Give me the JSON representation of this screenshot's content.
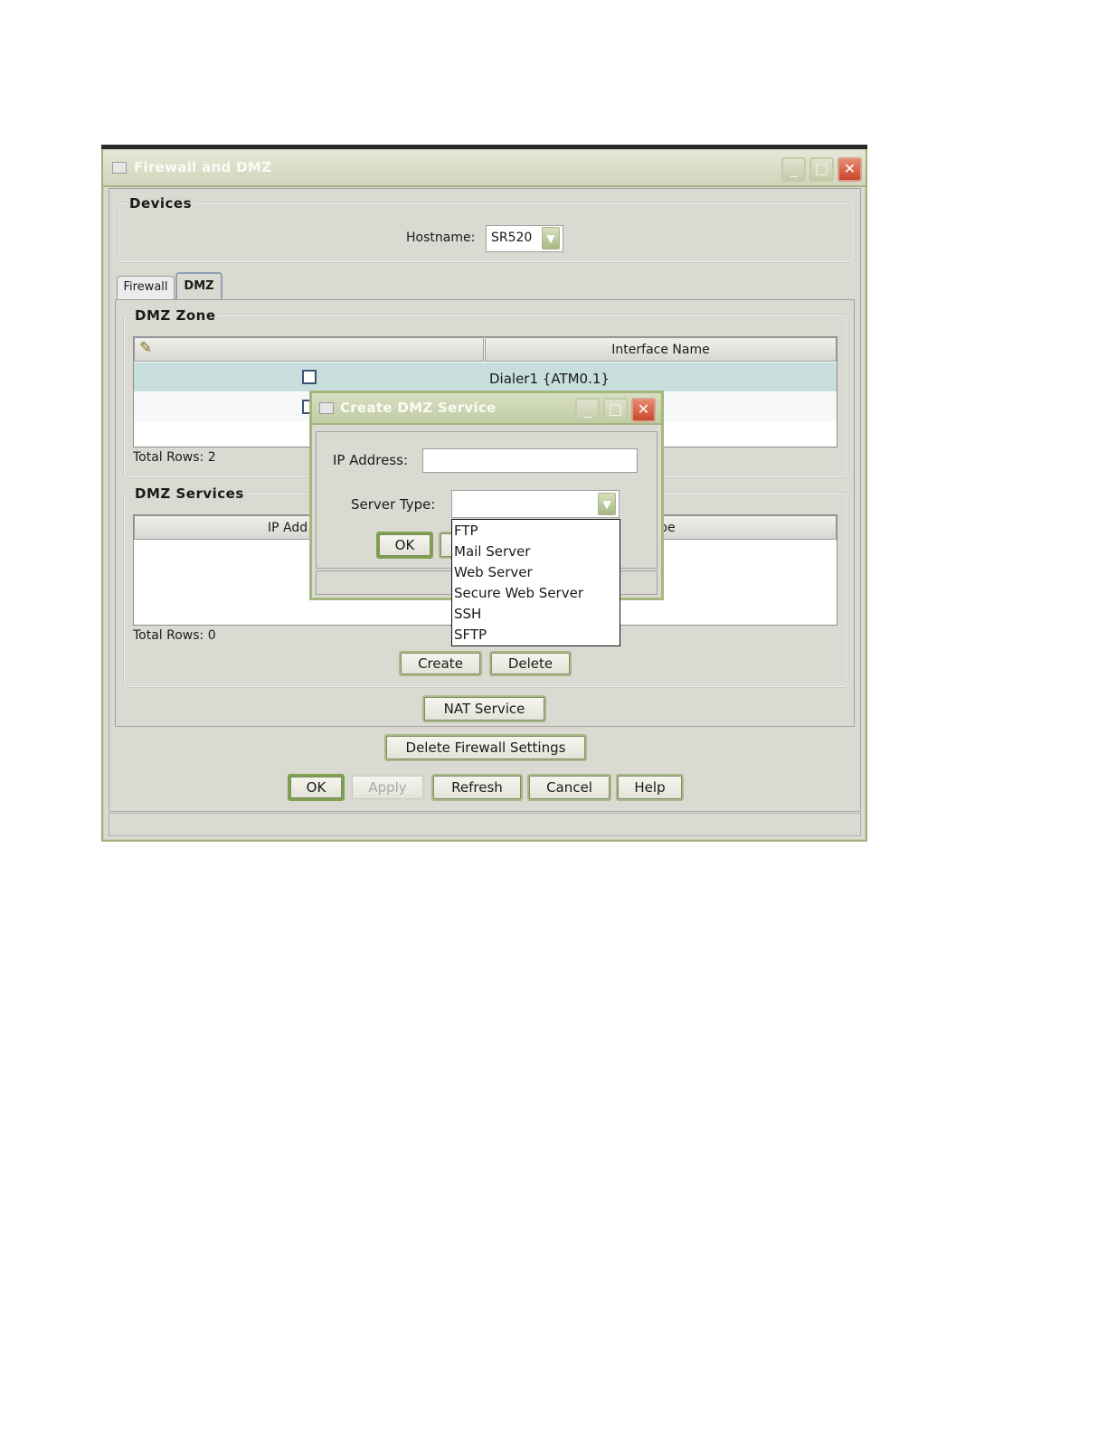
{
  "window": {
    "title": "Firewall and DMZ",
    "devices": {
      "legend": "Devices",
      "hostname_label": "Hostname:",
      "hostname_value": "SR520"
    },
    "tabs": [
      {
        "label": "Firewall",
        "active": false
      },
      {
        "label": "DMZ",
        "active": true
      }
    ],
    "dmz_zone": {
      "legend": "DMZ Zone",
      "column_header": "Interface Name",
      "rows": [
        {
          "interface": "Dialer1 {ATM0.1}",
          "checked": false,
          "selected": true
        },
        {
          "interface": "",
          "checked": false,
          "selected": false
        }
      ],
      "total_rows": "Total Rows: 2"
    },
    "dmz_services": {
      "legend": "DMZ Services",
      "col_ip_partial": "IP Add",
      "col_type_partial": "Type",
      "total_rows": "Total Rows: 0",
      "create_label": "Create",
      "delete_label": "Delete"
    },
    "nat_service_label": "NAT Service",
    "delete_firewall_label": "Delete Firewall Settings",
    "buttons": {
      "ok": "OK",
      "apply": "Apply",
      "refresh": "Refresh",
      "cancel": "Cancel",
      "help": "Help"
    }
  },
  "dialog": {
    "title": "Create DMZ Service",
    "ip_label": "IP Address:",
    "ip_value": "",
    "server_type_label": "Server Type:",
    "server_type_value": "",
    "ok_label": "OK",
    "options": [
      "FTP",
      "Mail Server",
      "Web Server",
      "Secure Web Server",
      "SSH",
      "SFTP"
    ]
  },
  "colors": {
    "frame_green": "#a4b77d",
    "selected_row": "#c8dedd",
    "close_red": "#c9472b"
  }
}
